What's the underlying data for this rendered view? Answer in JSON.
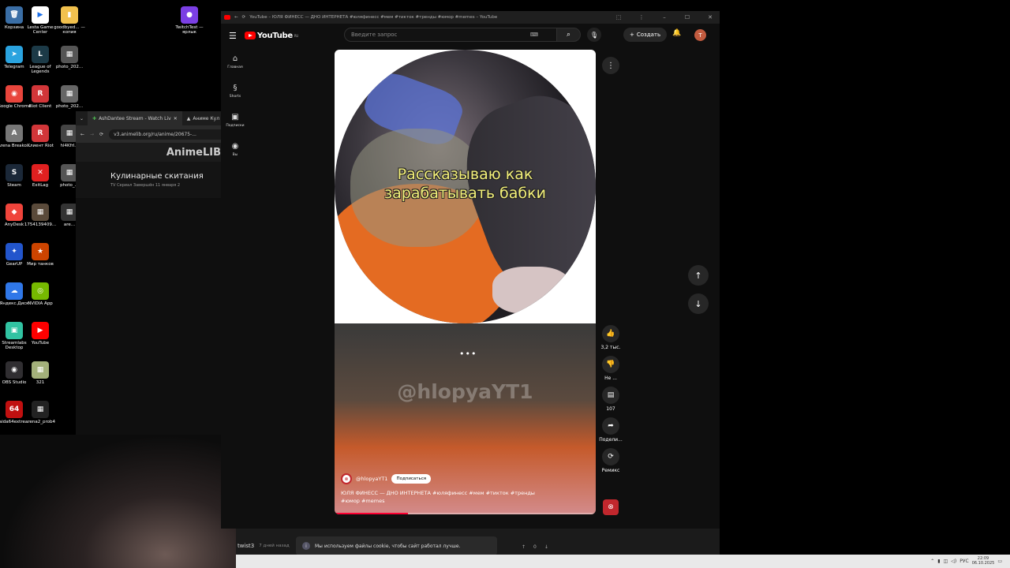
{
  "desktop_icons": [
    {
      "label": "Корзина",
      "bg": "#3a6ea5",
      "glyph": "🗑"
    },
    {
      "label": "Lesta Game Center",
      "bg": "#ffffff",
      "glyph": "▶"
    },
    {
      "label": "goodbyed... — копия",
      "bg": "#f2c14e",
      "glyph": "▮"
    },
    {
      "label": "TwitchTest — ярлык",
      "bg": "#7b3fe4",
      "glyph": "●"
    },
    {
      "label": "Telegram",
      "bg": "#2aa3df",
      "glyph": "➤"
    },
    {
      "label": "League of Legends",
      "bg": "#1c3a47",
      "glyph": "L"
    },
    {
      "label": "photo_202...",
      "bg": "#555555",
      "glyph": "▦"
    },
    {
      "label": "Google Chrome",
      "bg": "#e8453c",
      "glyph": "◉"
    },
    {
      "label": "Riot Client",
      "bg": "#d13639",
      "glyph": "R"
    },
    {
      "label": "photo_202...",
      "bg": "#666666",
      "glyph": "▦"
    },
    {
      "label": "Arena Breako...",
      "bg": "#777777",
      "glyph": "A"
    },
    {
      "label": "Клиент Riot",
      "bg": "#d13639",
      "glyph": "R"
    },
    {
      "label": "hl4Kfrl...",
      "bg": "#444444",
      "glyph": "▦"
    },
    {
      "label": "Steam",
      "bg": "#1b2838",
      "glyph": "S"
    },
    {
      "label": "ExitLag",
      "bg": "#e02020",
      "glyph": "✕"
    },
    {
      "label": "photo_...",
      "bg": "#555555",
      "glyph": "▦"
    },
    {
      "label": "AnyDesk",
      "bg": "#ef443b",
      "glyph": "◆"
    },
    {
      "label": "1754139409...",
      "bg": "#5a4a3a",
      "glyph": "▦"
    },
    {
      "label": "are...",
      "bg": "#333333",
      "glyph": "▦"
    },
    {
      "label": "GearUP",
      "bg": "#2255cc",
      "glyph": "✦"
    },
    {
      "label": "Мир танков",
      "bg": "#cc4400",
      "glyph": "★"
    },
    {
      "label": "Яндекс.Диск",
      "bg": "#2f77e8",
      "glyph": "☁"
    },
    {
      "label": "NVIDIA App",
      "bg": "#76b900",
      "glyph": "◎"
    },
    {
      "label": "Streamlabs Desktop",
      "bg": "#31c3a2",
      "glyph": "▣"
    },
    {
      "label": "YouTube",
      "bg": "#ff0000",
      "glyph": "▶"
    },
    {
      "label": "OBS Studio",
      "bg": "#302e31",
      "glyph": "◉"
    },
    {
      "label": "321",
      "bg": "#a3b07a",
      "glyph": "▦"
    },
    {
      "label": "aida64extre...",
      "bg": "#c01010",
      "glyph": "64"
    },
    {
      "label": "arena2_prob4",
      "bg": "#222222",
      "glyph": "▦"
    }
  ],
  "bg_browser": {
    "tabs": [
      "AshDantee Stream - Watch Liv",
      "Аниме Кул"
    ],
    "url": "v3.animelib.org/ru/anime/20675-...",
    "logo": "AnimeLIB",
    "title": "Кулинарные скитания",
    "meta": "TV Сериал   Завершён   11 января 2"
  },
  "browser": {
    "window_title": "YouTube – ЮЛЯ ФИНЕСС — ДНО ИНТЕРНЕТА #юляфинесс #мем #тикток #тренды #юмор #memes – YouTube"
  },
  "yt": {
    "logo_text": "YouTube",
    "logo_sup": "RU",
    "search_placeholder": "Введите запрос",
    "create_label": "Создать",
    "avatar_letter": "T",
    "nav": [
      {
        "label": "Главная",
        "icon": "home-icon",
        "glyph": "⌂"
      },
      {
        "label": "Shorts",
        "icon": "shorts-icon",
        "glyph": "§"
      },
      {
        "label": "Подписки",
        "icon": "subscriptions-icon",
        "glyph": "▣"
      },
      {
        "label": "Вы",
        "icon": "you-icon",
        "glyph": "◉"
      }
    ]
  },
  "short": {
    "caption_line1": "Рассказываю как",
    "caption_line2": "зарабатывать бабки",
    "watermark": "@hlopyaYT1",
    "channel": "@hlopyaYT1",
    "subscribe_label": "Подписаться",
    "title": "ЮЛЯ ФИНЕСС — ДНО ИНТЕРНЕТА #юляфинесс #мем #тикток #тренды #юмор #memes",
    "progress": 0.28
  },
  "actions": [
    {
      "name": "like",
      "icon": "thumbs-up-icon",
      "glyph": "👍",
      "label": "3,2 тыс."
    },
    {
      "name": "dislike",
      "icon": "thumbs-down-icon",
      "glyph": "👎",
      "label": "Не ..."
    },
    {
      "name": "comments",
      "icon": "comment-icon",
      "glyph": "▤",
      "label": "107"
    },
    {
      "name": "share",
      "icon": "share-icon",
      "glyph": "➦",
      "label": "Подели..."
    },
    {
      "name": "remix",
      "icon": "remix-icon",
      "glyph": "⟳",
      "label": "Ремикс"
    }
  ],
  "bottom": {
    "comment_user": "twist3",
    "comment_time": "7 дней назад",
    "cookie_text": "Мы используем файлы cookie, чтобы сайт работал лучше.",
    "upvotes": "0"
  },
  "tray": {
    "lang": "РУС",
    "time": "22:09",
    "date": "06.10.2025"
  }
}
